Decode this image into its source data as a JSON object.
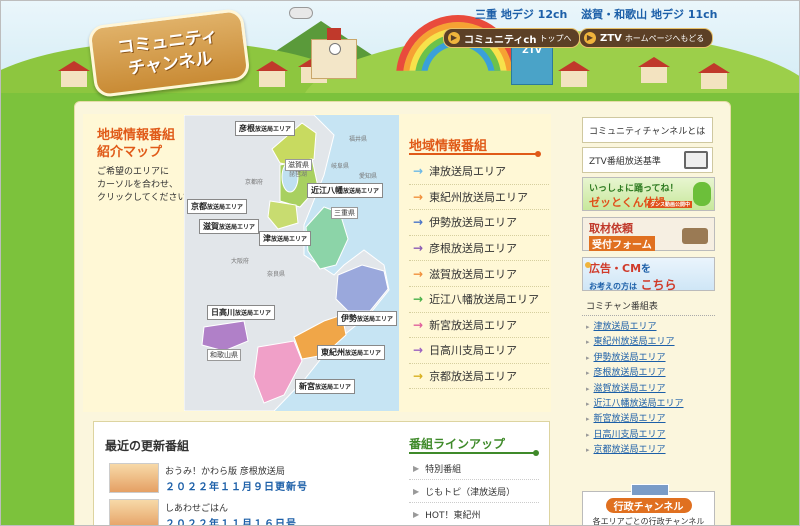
{
  "header": {
    "logo_line1": "コミュニティ",
    "logo_line2": "チャンネル",
    "channel_mie": "三重 地デジ 12ch",
    "channel_shiga": "滋賀・和歌山 地デジ 11ch",
    "btn_community": "コミュニティch",
    "btn_community_sub": "トップへ",
    "btn_ztv": "ZTV",
    "btn_ztv_sub": "ホームページへもどる",
    "building_sign": "ZTV"
  },
  "map": {
    "title_line1": "地域情報番組",
    "title_line2": "紹介マップ",
    "desc_line1": "ご希望のエリアに",
    "desc_line2": "カーソルを合わせ、",
    "desc_line3": "クリックしてください。",
    "area_labels": [
      {
        "name": "彦根",
        "suffix": "放送局エリア"
      },
      {
        "name": "近江八幡",
        "suffix": "放送局エリア"
      },
      {
        "name": "京都",
        "suffix": "放送局エリア"
      },
      {
        "name": "滋賀",
        "suffix": "放送局エリア"
      },
      {
        "name": "津",
        "suffix": "放送局エリア"
      },
      {
        "name": "日高川",
        "suffix": "放送局エリア"
      },
      {
        "name": "伊勢",
        "suffix": "放送局エリア"
      },
      {
        "name": "東紀州",
        "suffix": "放送局エリア"
      },
      {
        "name": "新宮",
        "suffix": "放送局エリア"
      }
    ],
    "pref_shiga": "滋賀県",
    "pref_mie": "三重県",
    "pref_wakayama": "和歌山県",
    "geo": [
      "福井県",
      "京都府",
      "岐阜県",
      "大阪府",
      "奈良県",
      "愛知県",
      "琵琶湖"
    ]
  },
  "regions": {
    "heading": "地域情報番組",
    "items": [
      {
        "label": "津放送局エリア",
        "color": "#6cb8e6"
      },
      {
        "label": "東紀州放送局エリア",
        "color": "#f0903c"
      },
      {
        "label": "伊勢放送局エリア",
        "color": "#4a74c8"
      },
      {
        "label": "彦根放送局エリア",
        "color": "#8a5ab4"
      },
      {
        "label": "滋賀放送局エリア",
        "color": "#f0903c"
      },
      {
        "label": "近江八幡放送局エリア",
        "color": "#48b048"
      },
      {
        "label": "新宮放送局エリア",
        "color": "#e0609c"
      },
      {
        "label": "日高川支局エリア",
        "color": "#9a60c0"
      },
      {
        "label": "京都放送局エリア",
        "color": "#d8b020"
      }
    ]
  },
  "recent": {
    "heading": "最近の更新番組",
    "items": [
      {
        "title": "おうみ！かわら版 彦根放送局",
        "date": "２０２２年１１月９日更新号"
      },
      {
        "title": "しあわせごはん",
        "date": "２０２２年１１月１６日号"
      }
    ]
  },
  "lineup": {
    "heading": "番組ラインアップ",
    "items": [
      "特別番組",
      "じもトピ（津放送局）",
      "HOT！東紀州"
    ]
  },
  "sidebar": {
    "about": "コミュニティチャンネルとは",
    "standards": "ZTV番組放送基準",
    "banner_zettokun_line1": "いっしょに踊ってね！",
    "banner_zettokun_line2": "ゼッとくん体操",
    "banner_zettokun_tag": "ダンス動画公開中",
    "banner_request_line1": "取材依頼",
    "banner_request_line2": "受付フォーム",
    "banner_ad_line1": "広告・CM",
    "banner_ad_mid": "を",
    "banner_ad_line2": "お考えの方は",
    "banner_ad_line3": "こちら",
    "schedule_heading": "コミチャン番組表",
    "schedule_items": [
      "津放送局エリア",
      "東紀州放送局エリア",
      "伊勢放送局エリア",
      "彦根放送局エリア",
      "滋賀放送局エリア",
      "近江八幡放送局エリア",
      "新宮放送局エリア",
      "日高川支局エリア",
      "京都放送局エリア"
    ],
    "gyosei_title": "行政チャンネル",
    "gyosei_sub": "各エリアごとの行政チャンネル"
  },
  "colors": {
    "accent_orange": "#e05a18",
    "link_blue": "#1c5fa8",
    "lineup_green": "#3f8a2a"
  }
}
